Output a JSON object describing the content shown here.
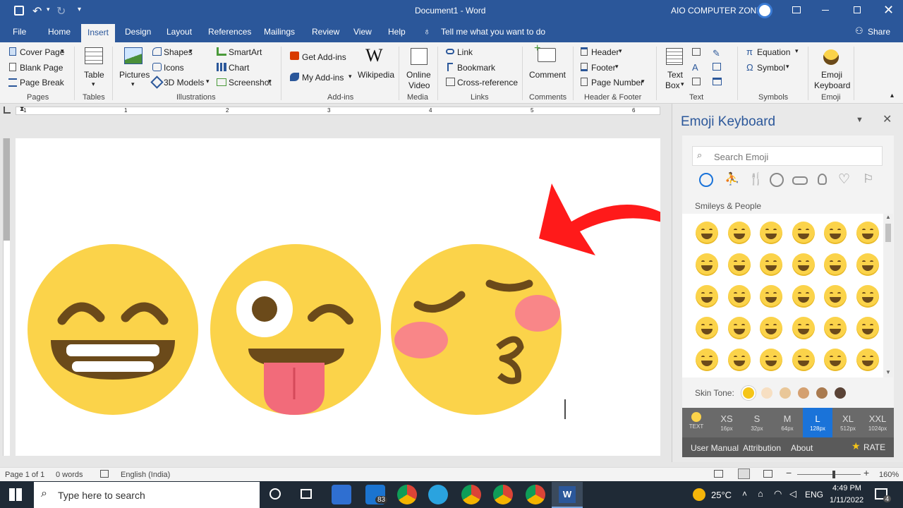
{
  "window": {
    "title": "Document1  -  Word",
    "account": "AIO COMPUTER ZONE"
  },
  "tabs": [
    {
      "label": "File"
    },
    {
      "label": "Home"
    },
    {
      "label": "Insert"
    },
    {
      "label": "Design"
    },
    {
      "label": "Layout"
    },
    {
      "label": "References"
    },
    {
      "label": "Mailings"
    },
    {
      "label": "Review"
    },
    {
      "label": "View"
    },
    {
      "label": "Help"
    }
  ],
  "tellme": "Tell me what you want to do",
  "share": "Share",
  "ribbon": {
    "pages": {
      "cover": "Cover Page",
      "blank": "Blank Page",
      "break": "Page Break",
      "group": "Pages"
    },
    "tables": {
      "table": "Table",
      "group": "Tables"
    },
    "illus": {
      "pictures": "Pictures",
      "shapes": "Shapes",
      "icons": "Icons",
      "models": "3D Models",
      "smartart": "SmartArt",
      "chart": "Chart",
      "screenshot": "Screenshot",
      "group": "Illustrations"
    },
    "addins": {
      "get": "Get Add-ins",
      "my": "My Add-ins",
      "wiki": "Wikipedia",
      "group": "Add-ins"
    },
    "media": {
      "video1": "Online",
      "video2": "Video",
      "group": "Media"
    },
    "links": {
      "link": "Link",
      "bookmark": "Bookmark",
      "crossref": "Cross-reference",
      "group": "Links"
    },
    "comments": {
      "comment": "Comment",
      "group": "Comments"
    },
    "hf": {
      "header": "Header",
      "footer": "Footer",
      "pagenum": "Page Number",
      "group": "Header & Footer"
    },
    "text": {
      "tb1": "Text",
      "tb2": "Box",
      "group": "Text"
    },
    "symbols": {
      "equation": "Equation",
      "symbol": "Symbol",
      "group": "Symbols"
    },
    "emoji": {
      "k1": "Emoji",
      "k2": "Keyboard",
      "group": "Emoji"
    }
  },
  "ruler": {
    "marks": [
      "1",
      "1",
      "2",
      "3",
      "4",
      "5",
      "6"
    ]
  },
  "pane": {
    "title": "Emoji Keyboard",
    "search_placeholder": "Search Emoji",
    "category_label": "Smileys & People",
    "categories": [
      "smiley-icon",
      "person-icon",
      "food-icon",
      "ball-icon",
      "car-icon",
      "bulb-icon",
      "heart-icon",
      "flag-icon"
    ],
    "skin_tone_label": "Skin Tone:",
    "skin_tones": [
      "#f5c518",
      "#f7dfc2",
      "#e9c799",
      "#d4a070",
      "#a97a4f",
      "#5a4336"
    ],
    "sizes": [
      {
        "label": "TEXT",
        "px": ""
      },
      {
        "label": "XS",
        "px": "16px"
      },
      {
        "label": "S",
        "px": "32px"
      },
      {
        "label": "M",
        "px": "64px"
      },
      {
        "label": "L",
        "px": "128px"
      },
      {
        "label": "XL",
        "px": "512px"
      },
      {
        "label": "XXL",
        "px": "1024px"
      }
    ],
    "footer": {
      "manual": "User Manual",
      "attribution": "Attribution",
      "about": "About",
      "rate": "RATE"
    }
  },
  "status": {
    "page": "Page 1 of 1",
    "words": "0 words",
    "lang": "English (India)",
    "zoom": "160%"
  },
  "taskbar": {
    "search": "Type here to search",
    "badge": "83",
    "weather": "25°C",
    "lang": "ENG",
    "time": "4:49 PM",
    "date": "1/11/2022",
    "notif": "4"
  },
  "colors": {
    "accent": "#2b579a",
    "emoji_yellow": "#fbd34a",
    "arrow": "#ff1a1a",
    "size_selected": "#1a73d9"
  }
}
